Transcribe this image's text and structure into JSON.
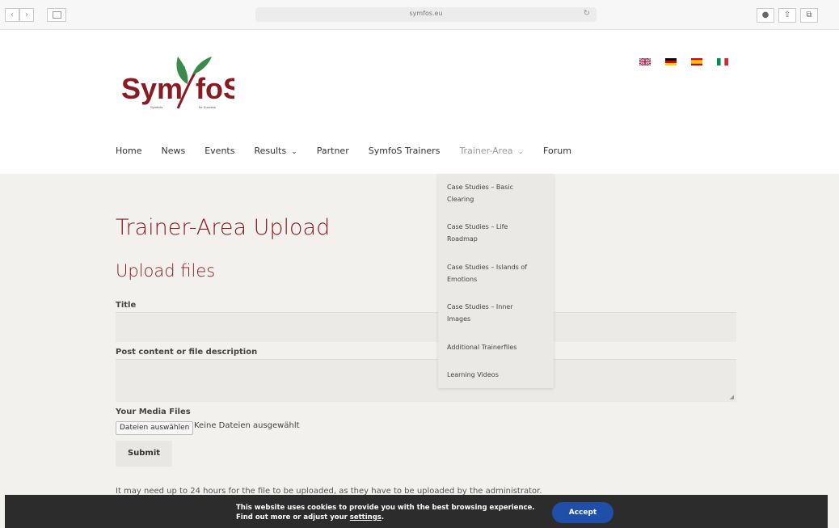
{
  "browser": {
    "url": "symfos.eu"
  },
  "logo": {
    "left_word": "Sym",
    "right_word": "foS",
    "left_sub": "Symbols",
    "right_sub": "for Success"
  },
  "nav": {
    "items": [
      {
        "label": "Home"
      },
      {
        "label": "News"
      },
      {
        "label": "Events"
      },
      {
        "label": "Results"
      },
      {
        "label": "Partner"
      },
      {
        "label": "SymfoS Trainers"
      },
      {
        "label": "Trainer-Area"
      },
      {
        "label": "Forum"
      }
    ]
  },
  "dropdown": {
    "items": [
      {
        "line1": "Case Studies – Basic",
        "line2": "Clearing"
      },
      {
        "line1": "Case Studies – Life",
        "line2": "Roadmap"
      },
      {
        "line1": "Case Studies – Islands of",
        "line2": "Emotions"
      },
      {
        "line1": "Case Studies – Inner",
        "line2": "Images"
      },
      {
        "line1": "Additional Trainerfiles",
        "line2": ""
      },
      {
        "line1": "Learning Videos",
        "line2": ""
      }
    ]
  },
  "main": {
    "page_title": "Trainer-Area Upload",
    "section_title": "Upload files",
    "title_label": "Title",
    "description_label": "Post content or file description",
    "media_label": "Your Media Files",
    "file_button": "Dateien auswählen",
    "file_status": "Keine Dateien ausgewählt",
    "submit_label": "Submit",
    "note": "It may need up to 24 hours for the file to be uploaded, as they have to be uploaded by the administrator."
  },
  "cookie": {
    "line1": "This website uses cookies to provide you with the best browsing experience.",
    "line2_prefix": "Find out more or adjust your ",
    "line2_link": "settings",
    "line2_suffix": ".",
    "accept_label": "Accept"
  },
  "colors": {
    "brand": "#8b1b22",
    "accent_button": "#1f4fa8"
  }
}
